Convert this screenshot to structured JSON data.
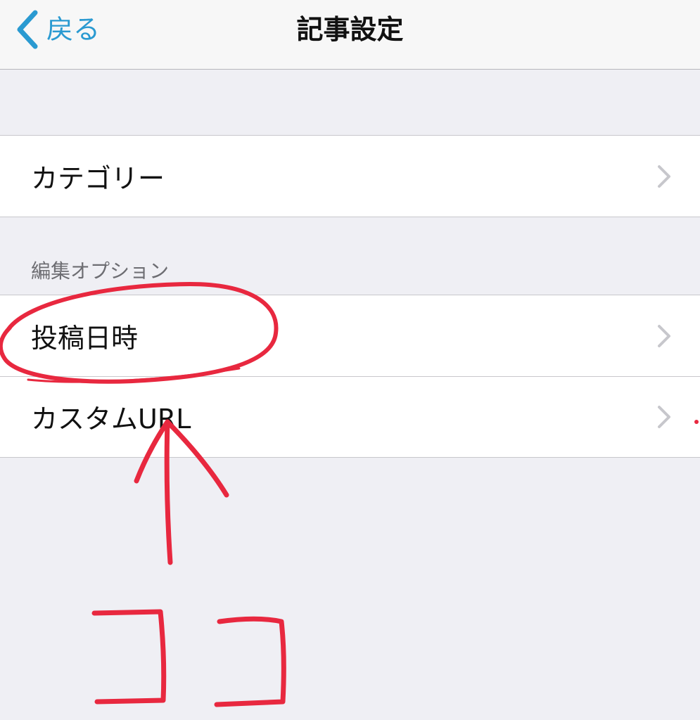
{
  "navbar": {
    "back_label": "戻る",
    "title": "記事設定",
    "back_icon": "chevron-left-icon"
  },
  "groups": [
    {
      "header": "",
      "items": [
        {
          "label": "カテゴリー",
          "icon": "chevron-right-icon"
        }
      ]
    },
    {
      "header": "編集オプション",
      "items": [
        {
          "label": "投稿日時",
          "icon": "chevron-right-icon"
        },
        {
          "label": "カスタムURL",
          "icon": "chevron-right-icon"
        }
      ]
    }
  ],
  "colors": {
    "background": "#efeff4",
    "navbar": "#f7f7f7",
    "accent": "#2a9ad1",
    "separator": "#c8c7cc",
    "chevron": "#c7c7cc",
    "annotation": "#e8283f"
  }
}
